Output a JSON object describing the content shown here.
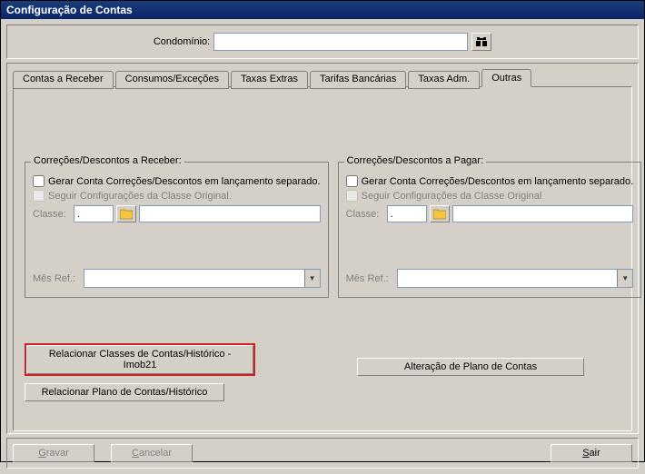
{
  "window": {
    "title": "Configuração de Contas"
  },
  "condo": {
    "label": "Condomínio:",
    "value": "",
    "search_icon": "binoculars-icon"
  },
  "tabs": [
    {
      "label": "Contas a Receber"
    },
    {
      "label": "Consumos/Exceções"
    },
    {
      "label": "Taxas Extras"
    },
    {
      "label": "Tarifas Bancárias"
    },
    {
      "label": "Taxas Adm."
    },
    {
      "label": "Outras"
    }
  ],
  "groups": {
    "left": {
      "legend": "Correções/Descontos a Receber:",
      "chk1": "Gerar Conta Correções/Descontos em lançamento separado.",
      "chk2": "Seguir Configurações da Classe Original.",
      "classe_label": "Classe:",
      "classe_code": ".",
      "classe_desc": "",
      "mesref_label": "Mês Ref.:",
      "mesref_value": ""
    },
    "right": {
      "legend": "Correções/Descontos a Pagar:",
      "chk1": "Gerar Conta Correções/Descontos em lançamento separado.",
      "chk2": "Seguir Configurações da Classe Original",
      "classe_label": "Classe:",
      "classe_code": ".",
      "classe_desc": "",
      "mesref_label": "Mês Ref.:",
      "mesref_value": ""
    }
  },
  "buttons": {
    "relacionar_classes": "Relacionar Classes de Contas/Histórico - Imob21",
    "alteracao_plano": "Alteração de Plano de Contas",
    "relacionar_plano": "Relacionar Plano de Contas/Histórico",
    "gravar": "Gravar",
    "cancelar": "Cancelar",
    "sair": "Sair"
  },
  "icons": {
    "folder": "📂",
    "binoculars": "🔍",
    "dropdown": "▼"
  }
}
